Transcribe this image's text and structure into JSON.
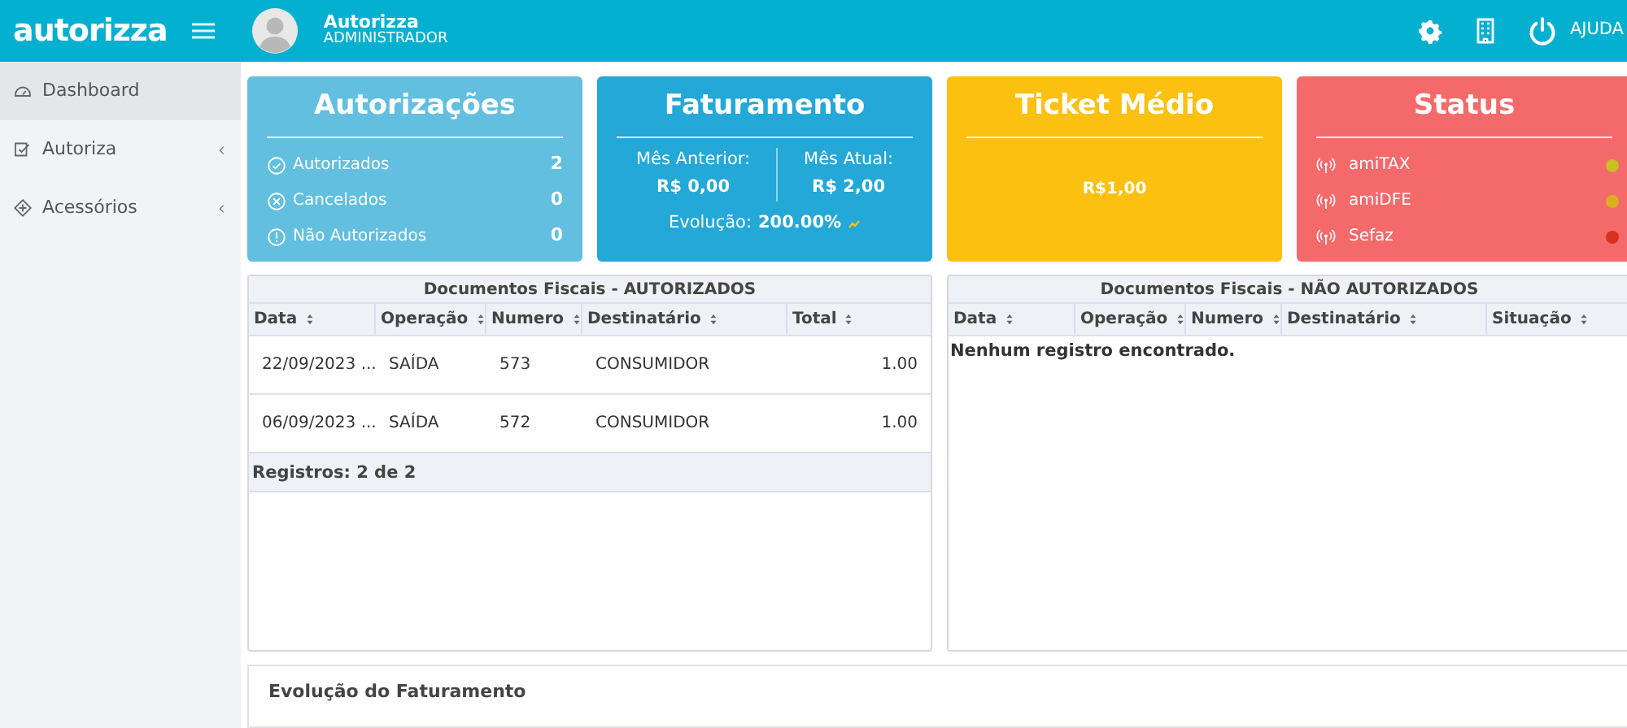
{
  "topbar": {
    "logo": "autorizza",
    "user_name": "Autorizza",
    "user_role": "ADMINISTRADOR",
    "help": "AJUDA"
  },
  "sidebar": {
    "items": [
      {
        "label": "Dashboard",
        "selected": true,
        "expandable": false
      },
      {
        "label": "Autoriza",
        "selected": false,
        "expandable": true
      },
      {
        "label": "Acessórios",
        "selected": false,
        "expandable": true
      }
    ]
  },
  "cards": {
    "autorizacoes": {
      "title": "Autorizações",
      "rows": [
        {
          "label": "Autorizados",
          "value": "2"
        },
        {
          "label": "Cancelados",
          "value": "0"
        },
        {
          "label": "Não Autorizados",
          "value": "0"
        }
      ]
    },
    "faturamento": {
      "title": "Faturamento",
      "previous_label": "Mês Anterior:",
      "previous_value": "R$ 0,00",
      "current_label": "Mês Atual:",
      "current_value": "R$ 2,00",
      "evolution_label": "Evolução:",
      "evolution_value": "200.00%"
    },
    "ticket": {
      "title": "Ticket Médio",
      "value": "R$1,00"
    },
    "status": {
      "title": "Status",
      "services": [
        {
          "name": "amiTAX",
          "color": "#c8c020"
        },
        {
          "name": "amiDFE",
          "color": "#d8b020"
        },
        {
          "name": "Sefaz",
          "color": "#d83020"
        }
      ]
    }
  },
  "tables": [
    {
      "title": "Documentos Fiscais - AUTORIZADOS",
      "columns": [
        "Data",
        "Operação",
        "Numero",
        "Destinatário",
        "Total"
      ],
      "rows": [
        [
          "22/09/2023 ...",
          "SAÍDA",
          "573",
          "CONSUMIDOR",
          "1.00"
        ],
        [
          "06/09/2023 ...",
          "SAÍDA",
          "572",
          "CONSUMIDOR",
          "1.00"
        ]
      ],
      "footer": "Registros: 2 de 2"
    },
    {
      "title": "Documentos Fiscais - NÃO AUTORIZADOS",
      "columns": [
        "Data",
        "Operação",
        "Numero",
        "Destinatário",
        "Situação"
      ],
      "empty_message": "Nenhum registro encontrado."
    }
  ],
  "chart_panel": {
    "title": "Evolução do Faturamento"
  }
}
